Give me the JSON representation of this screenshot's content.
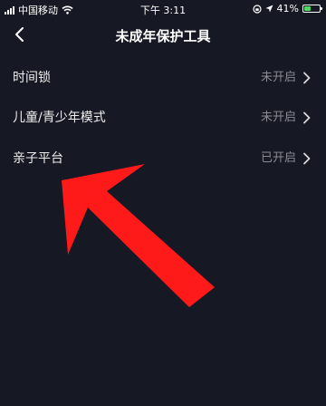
{
  "status_bar": {
    "carrier": "中国移动",
    "time": "下午 3:11",
    "battery": "41%",
    "battery_level": 0.41
  },
  "header": {
    "title": "未成年保护工具"
  },
  "settings": [
    {
      "label": "时间锁",
      "status": "未开启"
    },
    {
      "label": "儿童/青少年模式",
      "status": "未开启"
    },
    {
      "label": "亲子平台",
      "status": "已开启"
    }
  ],
  "colors": {
    "background": "#161824",
    "annotation_arrow": "#ff1a1a",
    "status_text": "#8a8b93",
    "battery_charging": "#4cd964"
  },
  "icons": {
    "back": "chevron-left-icon",
    "row_chevron": "chevron-right-icon",
    "wifi": "wifi-icon",
    "location": "location-icon",
    "lock_rotation": "rotation-lock-icon"
  }
}
